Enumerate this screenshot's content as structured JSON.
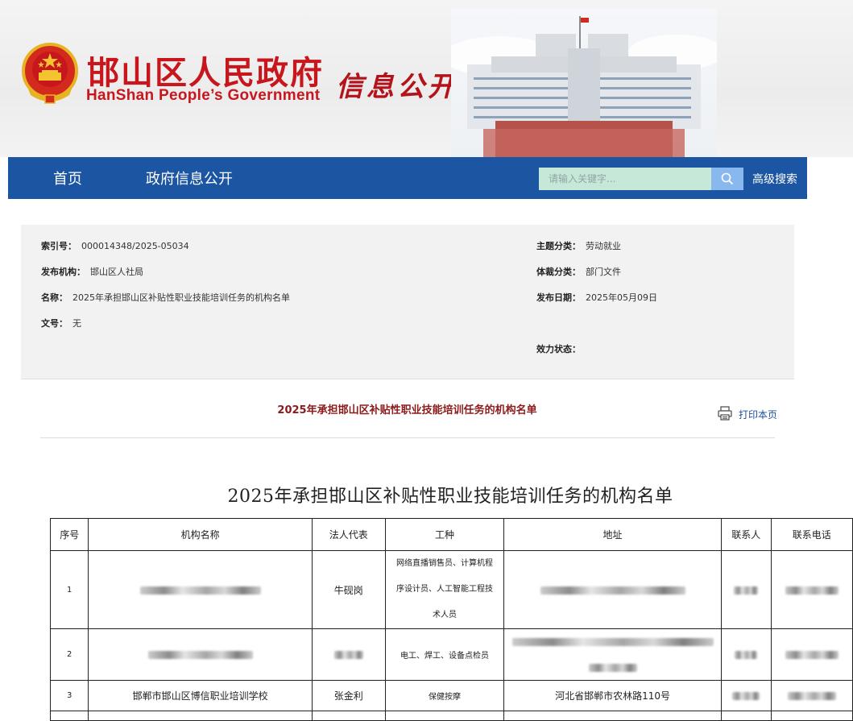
{
  "banner": {
    "name_cn": "邯山区人民政府",
    "name_en": "HanShan People’s Government",
    "section": "信息公开",
    "colors": {
      "brand_red": "#c8161d",
      "nav_blue": "#1c55a1"
    }
  },
  "nav": {
    "items": [
      {
        "label": "首页"
      },
      {
        "label": "政府信息公开"
      }
    ],
    "search_placeholder": "请输入关键字...",
    "search_icon": "search-icon",
    "advanced_search": "高级搜索"
  },
  "meta": {
    "index_no": {
      "key": "索引号：",
      "value": "000014348/2025-05034"
    },
    "publisher": {
      "key": "发布机构：",
      "value": "邯山区人社局"
    },
    "name": {
      "key": "名称：",
      "value": "2025年承担邯山区补贴性职业技能培训任务的机构名单"
    },
    "doc_no": {
      "key": "文号：",
      "value": "无"
    },
    "topic": {
      "key": "主题分类：",
      "value": "劳动就业"
    },
    "genre": {
      "key": "体裁分类：",
      "value": "部门文件"
    },
    "date": {
      "key": "发布日期：",
      "value": "2025年05月09日"
    },
    "status": {
      "key": "效力状态：",
      "value": ""
    }
  },
  "article": {
    "title": "2025年承担邯山区补贴性职业技能培训任务的机构名单",
    "print_label": "打印本页",
    "heading": "2025年承担邯山区补贴性职业技能培训任务的机构名单"
  },
  "table": {
    "headers": [
      "序号",
      "机构名称",
      "法人代表",
      "工种",
      "地址",
      "联系人",
      "联系电话"
    ],
    "rows": [
      {
        "no": "1",
        "name": "",
        "rep": "牛砚岗",
        "trades": [
          "网络直播销售员、计算机程",
          "序设计员、人工智能工程技",
          "术人员"
        ],
        "address": "",
        "contact": "",
        "phone": ""
      },
      {
        "no": "2",
        "name": "",
        "rep": "",
        "trades": [
          "电工、焊工、设备点检员"
        ],
        "address": "",
        "contact": "",
        "phone": ""
      },
      {
        "no": "3",
        "name": "邯郸市邯山区博信职业培训学校",
        "rep": "张金利",
        "trades": [
          "保健按摩"
        ],
        "address": "河北省邯郸市农林路110号",
        "contact": "",
        "phone": ""
      }
    ]
  }
}
